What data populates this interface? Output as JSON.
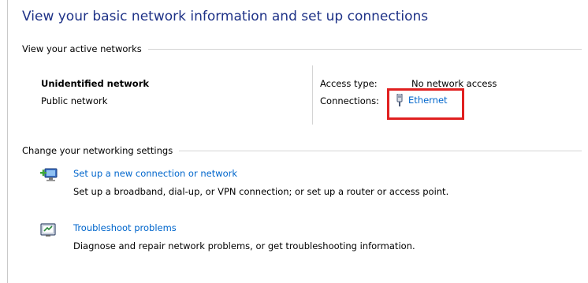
{
  "title": "View your basic network information and set up connections",
  "active_networks": {
    "header": "View your active networks",
    "network_name": "Unidentified network",
    "network_type": "Public network",
    "access_type_label": "Access type:",
    "access_type_value": "No network access",
    "connections_label": "Connections:",
    "connection_link": "Ethernet",
    "connection_icon": "ethernet-adapter-icon"
  },
  "settings": {
    "header": "Change your networking settings",
    "tasks": [
      {
        "icon": "new-connection-icon",
        "link": "Set up a new connection or network",
        "description": "Set up a broadband, dial-up, or VPN connection; or set up a router or access point."
      },
      {
        "icon": "troubleshoot-icon",
        "link": "Troubleshoot problems",
        "description": "Diagnose and repair network problems, or get troubleshooting information."
      }
    ]
  },
  "colors": {
    "title": "#1e3287",
    "link": "#0066cc",
    "highlight": "#e02020"
  }
}
